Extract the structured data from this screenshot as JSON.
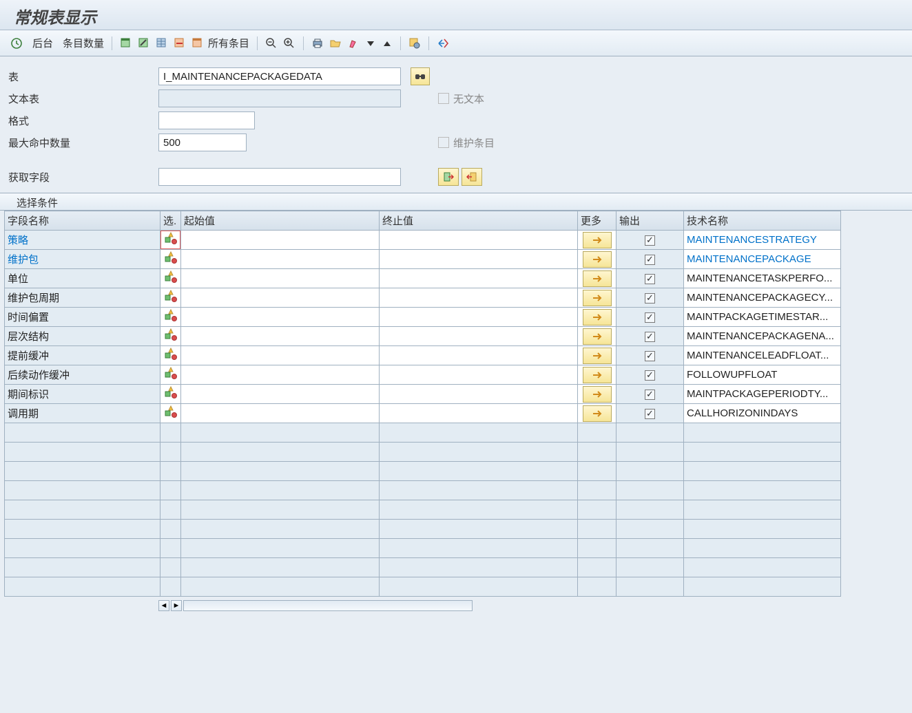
{
  "title": "常规表显示",
  "toolbar": {
    "background_label": "后台",
    "entry_count_label": "条目数量",
    "all_entries_label": "所有条目"
  },
  "form": {
    "table_label": "表",
    "table_value": "I_MAINTENANCEPACKAGEDATA",
    "text_table_label": "文本表",
    "text_table_value": "",
    "no_text_label": "无文本",
    "format_label": "格式",
    "format_value": "",
    "max_hits_label": "最大命中数量",
    "max_hits_value": "500",
    "maintain_entries_label": "维护条目",
    "get_fields_label": "获取字段",
    "get_fields_value": ""
  },
  "section_title": "选择条件",
  "columns": {
    "field_name": "字段名称",
    "select": "选.",
    "from": "起始值",
    "to": "终止值",
    "more": "更多",
    "output": "输出",
    "tech_name": "技术名称"
  },
  "rows": [
    {
      "label": "策略",
      "tech": "MAINTENANCESTRATEGY",
      "key": true,
      "checked": true
    },
    {
      "label": "维护包",
      "tech": "MAINTENANCEPACKAGE",
      "key": true,
      "checked": true
    },
    {
      "label": "单位",
      "tech": "MAINTENANCETASKPERFO...",
      "key": false,
      "checked": true
    },
    {
      "label": "维护包周期",
      "tech": "MAINTENANCEPACKAGECY...",
      "key": false,
      "checked": true
    },
    {
      "label": "时间偏置",
      "tech": "MAINTPACKAGETIMESTAR...",
      "key": false,
      "checked": true
    },
    {
      "label": "层次结构",
      "tech": "MAINTENANCEPACKAGENA...",
      "key": false,
      "checked": true
    },
    {
      "label": "提前缓冲",
      "tech": "MAINTENANCELEADFLOAT...",
      "key": false,
      "checked": true
    },
    {
      "label": "后续动作缓冲",
      "tech": "FOLLOWUPFLOAT",
      "key": false,
      "checked": true
    },
    {
      "label": "期间标识",
      "tech": "MAINTPACKAGEPERIODTY...",
      "key": false,
      "checked": true
    },
    {
      "label": "调用期",
      "tech": "CALLHORIZONINDAYS",
      "key": false,
      "checked": true
    }
  ],
  "empty_rows": 9
}
